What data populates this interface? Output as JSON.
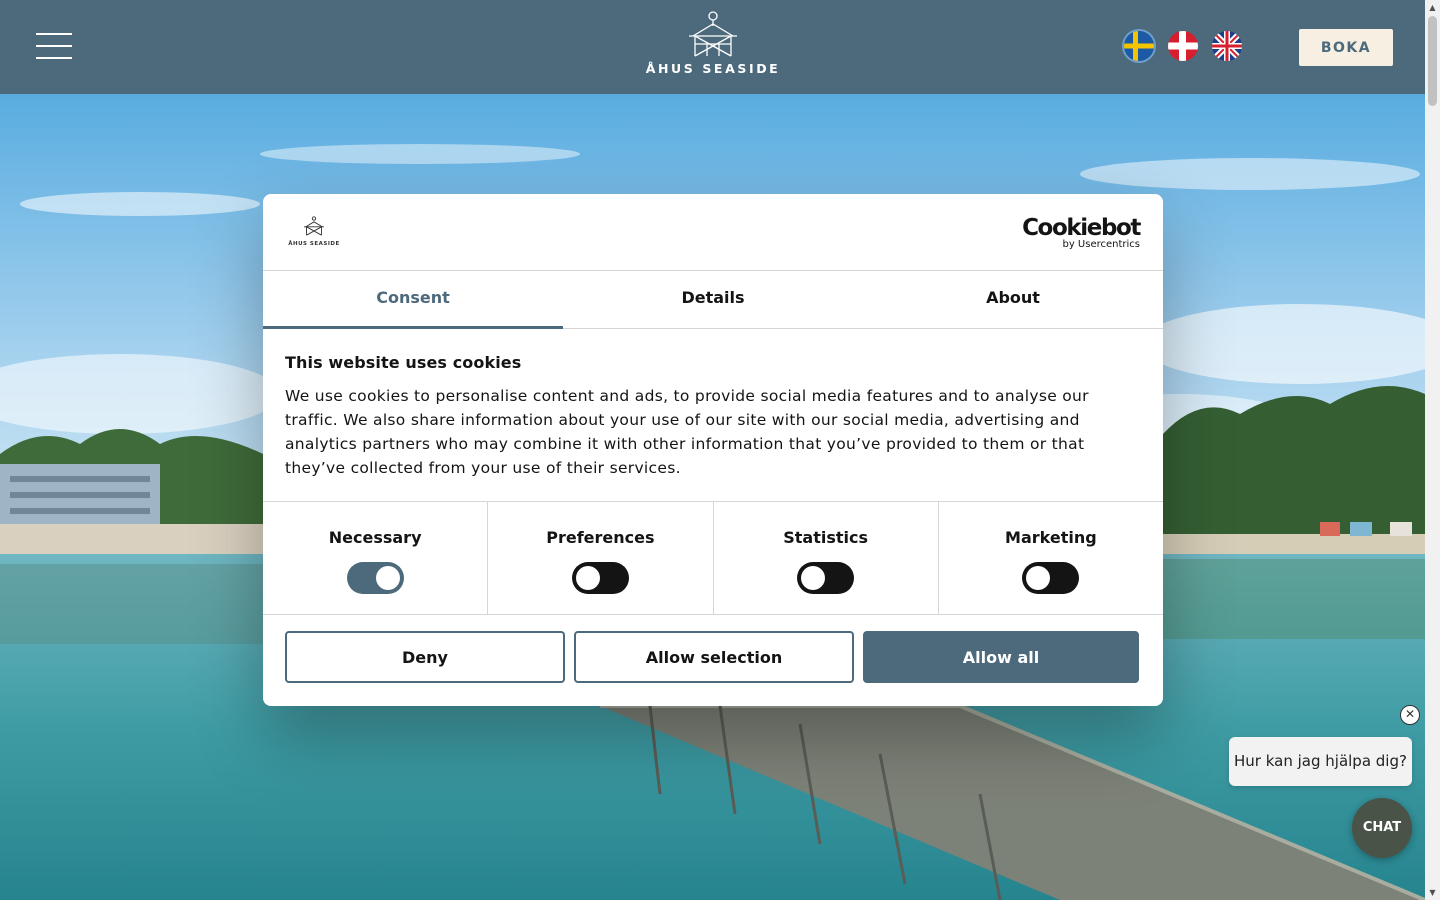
{
  "header": {
    "logo_text": "ÅHUS SEASIDE",
    "languages": [
      {
        "name": "Svenska",
        "code": "se",
        "active": true
      },
      {
        "name": "Dansk",
        "code": "dk",
        "active": false
      },
      {
        "name": "English",
        "code": "gb",
        "active": false
      }
    ],
    "boka_label": "BOKA"
  },
  "colors": {
    "header_bg": "#4d6a7d",
    "accent": "#4d6a7d",
    "boka_bg": "#f6efe2"
  },
  "dialog": {
    "logo_text": "ÅHUS SEASIDE",
    "brand": "Cookiebot",
    "brand_sub": "by Usercentrics",
    "tabs": [
      {
        "label": "Consent",
        "active": true
      },
      {
        "label": "Details",
        "active": false
      },
      {
        "label": "About",
        "active": false
      }
    ],
    "title": "This website uses cookies",
    "text": "We use cookies to personalise content and ads, to provide social media features and to analyse our traffic. We also share information about your use of our site with our social media, advertising and analytics partners who may combine it with other information that you’ve provided to them or that they’ve collected from your use of their services.",
    "categories": [
      {
        "label": "Necessary",
        "checked": true
      },
      {
        "label": "Preferences",
        "checked": false
      },
      {
        "label": "Statistics",
        "checked": false
      },
      {
        "label": "Marketing",
        "checked": false
      }
    ],
    "buttons": {
      "deny": "Deny",
      "allow_selection": "Allow selection",
      "allow_all": "Allow all"
    }
  },
  "chat": {
    "prompt": "Hur kan jag hjälpa dig?",
    "button_label": "CHAT",
    "close_symbol": "✕"
  },
  "icons": {
    "menu": "hamburger-menu-icon",
    "close": "close-icon"
  }
}
